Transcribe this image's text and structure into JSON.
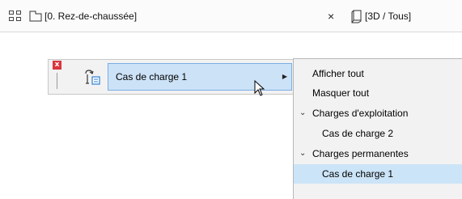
{
  "tabs": {
    "floor_label": "[0. Rez-de-chaussée]",
    "close_glyph": "×",
    "view3d_label": "[3D / Tous]"
  },
  "palette": {
    "close_glyph": "x",
    "dropdown_value": "Cas de charge 1",
    "arrow_glyph": "▶"
  },
  "menu": {
    "show_all": "Afficher tout",
    "hide_all": "Masquer tout",
    "group1_label": "Charges d'exploitation",
    "group1_item1": "Cas de charge 2",
    "group2_label": "Charges permanentes",
    "group2_item1": "Cas de charge 1",
    "chevron": "⌄"
  },
  "colors": {
    "selection": "#cce4f7",
    "close_red": "#d9363e"
  }
}
